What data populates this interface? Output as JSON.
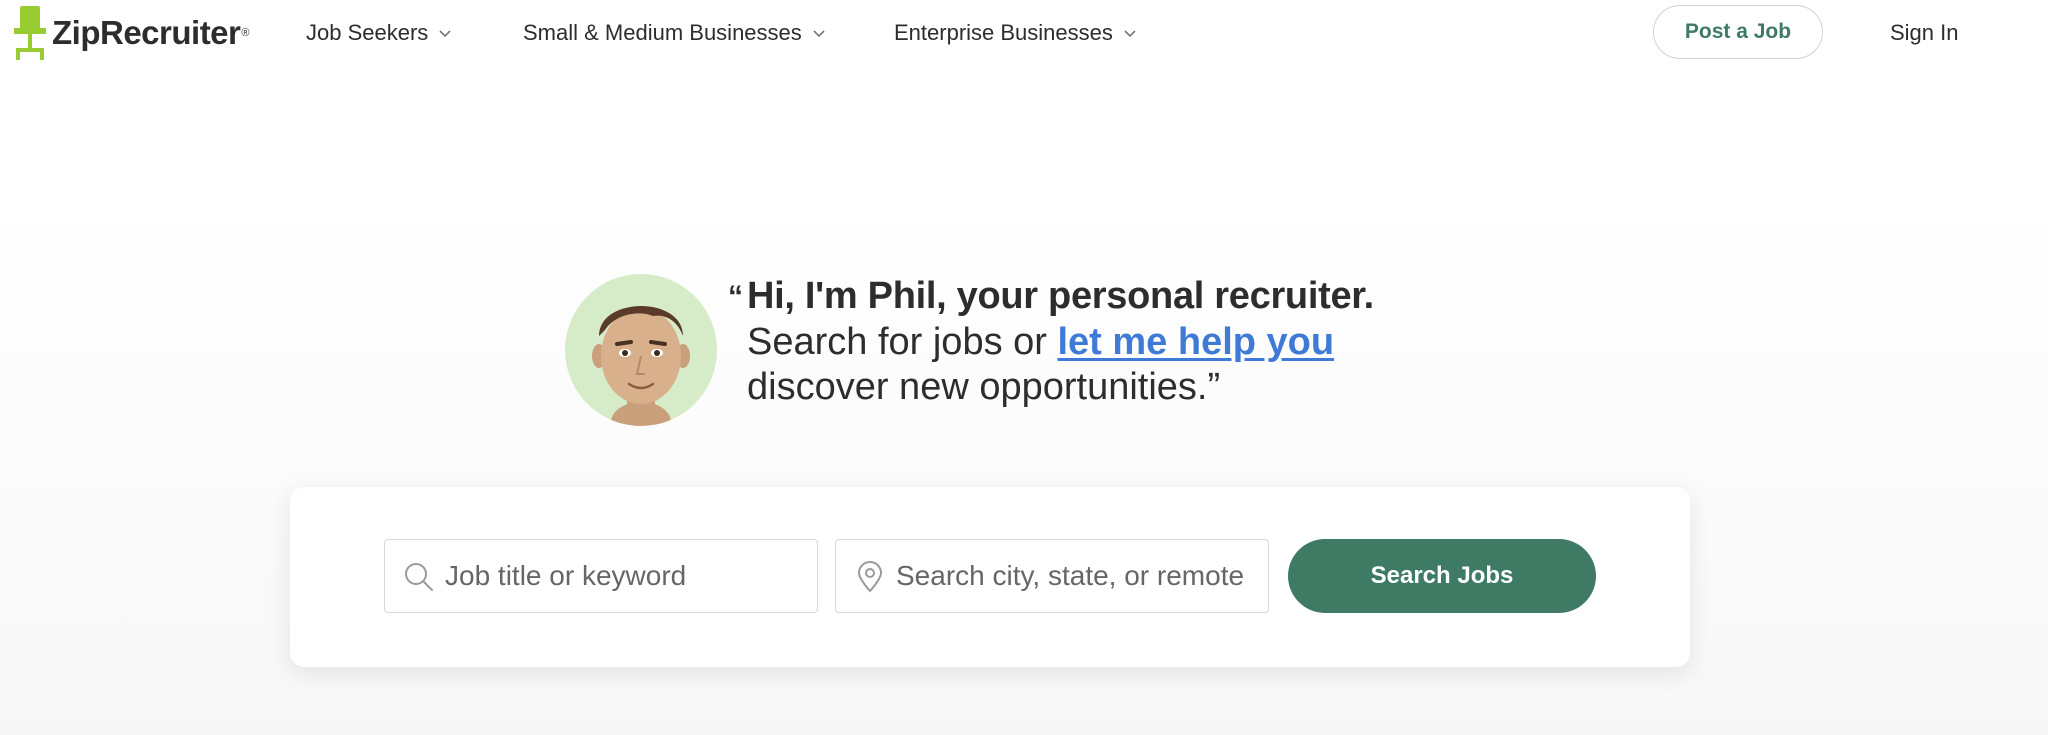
{
  "brand": {
    "name": "ZipRecruiter",
    "registered": "®",
    "logo_color": "#99cc33"
  },
  "nav": {
    "items": [
      {
        "label": "Job Seekers"
      },
      {
        "label": "Small & Medium Businesses"
      },
      {
        "label": "Enterprise Businesses"
      }
    ],
    "post_job": "Post a Job",
    "sign_in": "Sign In"
  },
  "hero": {
    "open_quote": "“",
    "headline": "Hi, I'm Phil, your personal recruiter.",
    "line2_prefix": "Search for jobs or ",
    "line2_link": "let me help you",
    "line3": "discover new opportunities.”"
  },
  "search": {
    "keyword_placeholder": "Job title or keyword",
    "location_placeholder": "Search city, state, or remote",
    "button": "Search Jobs"
  },
  "colors": {
    "accent_green": "#3e7a64",
    "link_blue": "#3f7ad6",
    "avatar_bg": "#d6ecc9"
  }
}
